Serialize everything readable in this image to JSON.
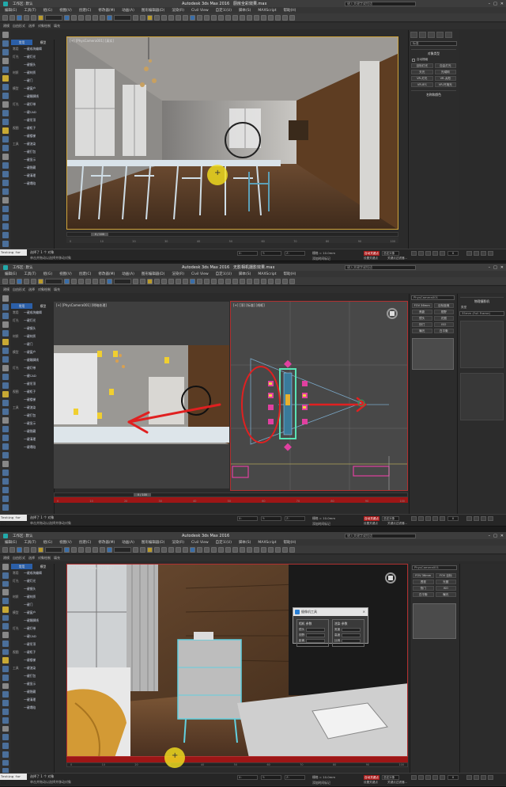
{
  "colors": {
    "cursor_highlight": "#f2de1e",
    "annotation_red": "#e02020",
    "auto_key": "#a81a1a",
    "plugin_tab_active": "#2b5fa8"
  },
  "app": {
    "title1": "Autodesk 3ds Max 2016",
    "file1": "厨房全彩效果.max",
    "title2": "Autodesk 3ds Max 2016",
    "file2": "无影相机摄影效果.max",
    "title3": "Autodesk 3ds Max 2016",
    "file3": "",
    "search_placeholder": "键入关键字或短语",
    "workspace": "工作区: 默认"
  },
  "menu": [
    "编辑(E)",
    "工具(T)",
    "组(G)",
    "视图(V)",
    "创建(C)",
    "修改器(M)",
    "动画(A)",
    "图形编辑器(D)",
    "渲染(R)",
    "Civil View",
    "自定义(U)",
    "脚本(S)",
    "MAXScript",
    "帮助(H)"
  ],
  "subtabs": [
    "建模",
    "自由形式",
    "选择",
    "对象绘制",
    "填充"
  ],
  "plugin": {
    "tabs": [
      "常用",
      "模型"
    ],
    "items": [
      {
        "cat": "常用",
        "label": "一键成块编辑"
      },
      {
        "cat": "灯光",
        "label": "一键灯光"
      },
      {
        "cat": "",
        "label": "一键镜头"
      },
      {
        "cat": "材质",
        "label": "一键材质"
      },
      {
        "cat": "",
        "label": "一键门"
      },
      {
        "cat": "模型",
        "label": "一键窗户"
      },
      {
        "cat": "",
        "label": "一键踢脚线"
      },
      {
        "cat": "灯光",
        "label": "一键灯带"
      },
      {
        "cat": "",
        "label": "一键CAD"
      },
      {
        "cat": "",
        "label": "一键吊顶"
      },
      {
        "cat": "视图",
        "label": "一键柜子"
      },
      {
        "cat": "",
        "label": "一键楼梯"
      },
      {
        "cat": "工具",
        "label": "一键渲染"
      },
      {
        "cat": "",
        "label": "一键打包"
      },
      {
        "cat": "",
        "label": "一键显示"
      },
      {
        "cat": "",
        "label": "一键隐藏"
      },
      {
        "cat": "",
        "label": "一键清理"
      },
      {
        "cat": "",
        "label": "一键塌陷"
      }
    ]
  },
  "viewports": {
    "v1_label": "[+] [PhysCamera001] [真实]",
    "v2a_label": "[+] [PhysCamera001] [明暗处理]",
    "v2b_label": "[+] [顶] [标准] [线框]",
    "v3_label": "[+] [PhysCamera001] [真实]"
  },
  "cmdpanel": {
    "p1_dropdown": "标准",
    "p1_head": "对象类型",
    "p1_autogrid": "自动栅格",
    "p1_buttons": [
      "目标灯光",
      "自由灯光",
      "天光",
      "光域网",
      "VR-灯光",
      "VR-太阳",
      "VR-IES",
      "VR-环境光"
    ],
    "p1_head2": "名称和颜色",
    "p2_dropdown": "PhysCamera001",
    "p2_head": "物理摄影机",
    "p2_buttons": [
      "FOV 36mm",
      "目标距离",
      "焦距",
      "视野",
      "镜头",
      "光圈",
      "快门",
      "ISO",
      "曝光",
      "白平衡"
    ],
    "p2_type_label": "类型",
    "p2_type_value": "35mm (Full Frame)",
    "p3_dropdown": "PhysCamera001",
    "p3_buttons": [
      "FOV 36mm",
      "FOV 目标",
      "透视",
      "光圈",
      "快门",
      "ISO",
      "白平衡",
      "曝光"
    ]
  },
  "timeline": {
    "frame_label": "0 / 100",
    "ticks": [
      "0",
      "10",
      "20",
      "30",
      "40",
      "50",
      "60",
      "70",
      "80",
      "90",
      "100"
    ]
  },
  "status": {
    "script_label": "Testing for All",
    "msg1": "选择了 1 个 对象",
    "msg2": "单击并拖动以选择并移动对象",
    "x_label": "X:",
    "y_label": "Y:",
    "z_label": "Z:",
    "grid": "栅格 = 10.0mm",
    "add_time_tag": "添加时间标记",
    "auto_key": "自动关键点",
    "set_key": "设置关键点",
    "selected": "选定对象",
    "key_filter": "关键点过滤器...",
    "frame": "0"
  },
  "dialog": {
    "title": "摄像机工具",
    "col1_head": "相机 参数",
    "col2_head": "渲染 参数",
    "rows1": [
      "镜头",
      "视野",
      "距离"
    ],
    "rows2": [
      "宽度",
      "高度",
      "比例"
    ],
    "close": "×"
  }
}
